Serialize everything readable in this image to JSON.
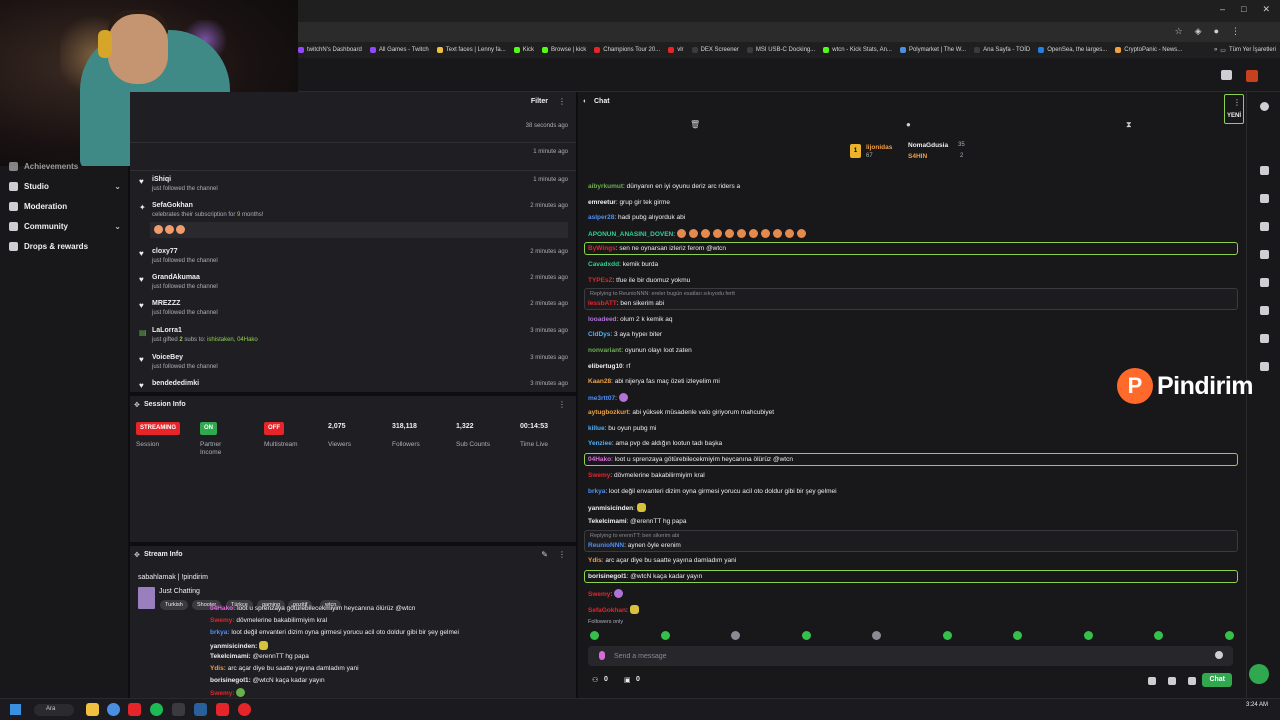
{
  "bookmarks": [
    "twitchN's Dashboard",
    "All Games - Twitch",
    "Text faces | Lenny fa...",
    "Kick",
    "Browse | kick",
    "Champions Tour 20...",
    "vlr",
    "DEX Screener",
    "MSI USB-C Docking...",
    "wtcn - Kick Stats, An...",
    "Polymarket | The W...",
    "Ana Sayfa - TOİD",
    "OpenSea, the larges...",
    "CryptoPanic - News..."
  ],
  "bookmarks_more": "Tüm Yer İşaretleri",
  "nav": {
    "partial_top": "Achievements",
    "items": [
      {
        "label": "Studio",
        "chevron": true
      },
      {
        "label": "Moderation",
        "chevron": false
      },
      {
        "label": "Community",
        "chevron": true
      },
      {
        "label": "Drops & rewards",
        "chevron": false
      }
    ]
  },
  "activity": {
    "filter_label": "Filter",
    "menu": "⋮",
    "top_times": [
      "38 seconds ago",
      "1 minute ago"
    ],
    "rows": [
      {
        "name": "iShiqi",
        "desc": "just followed the channel",
        "time": "1 minute ago",
        "icon": "heart"
      },
      {
        "name": "SefaGokhan",
        "desc_pre": "celebrates their subscription for ",
        "desc_num": "9",
        "desc_post": " months!",
        "time": "2 minutes ago",
        "icon": "star"
      },
      {
        "name": "cloxy77",
        "desc": "just followed the channel",
        "time": "2 minutes ago",
        "icon": "heart"
      },
      {
        "name": "GrandAkumaa",
        "desc": "just followed the channel",
        "time": "2 minutes ago",
        "icon": "heart"
      },
      {
        "name": "MREZZZ",
        "desc": "just followed the channel",
        "time": "2 minutes ago",
        "icon": "heart"
      },
      {
        "name": "LaLorra1",
        "desc_pre": "just gifted ",
        "desc_num": "2",
        "desc_mid": " subs to: ",
        "desc_post": "ishistaken, 04Hako",
        "time": "3 minutes ago",
        "icon": "gift"
      },
      {
        "name": "VoiceBey",
        "desc": "just followed the channel",
        "time": "3 minutes ago",
        "icon": "heart"
      },
      {
        "name": "bendededimki",
        "desc": "",
        "time": "3 minutes ago",
        "icon": "heart"
      }
    ]
  },
  "session": {
    "title": "Session Info",
    "menu": "⋮",
    "badges": [
      {
        "text": "STREAMING",
        "label": "Session",
        "color": "#e5252a"
      },
      {
        "text": "ON",
        "label": "Partner Income",
        "color": "#2fa84f"
      },
      {
        "text": "OFF",
        "label": "Multistream",
        "color": "#e5252a"
      }
    ],
    "stats": [
      {
        "value": "2,075",
        "label": "Viewers"
      },
      {
        "value": "318,118",
        "label": "Followers"
      },
      {
        "value": "1,322",
        "label": "Sub Counts"
      },
      {
        "value": "00:14:53",
        "label": "Time Live"
      }
    ]
  },
  "stream_info": {
    "title": "Stream Info",
    "stream_title": "sabahlamak | !pindirim",
    "game": "Just Chatting",
    "tags": [
      "Turkish",
      "Shooter",
      "Türkçe",
      "gaming",
      "pozitif",
      "wtcn"
    ],
    "chat_lines": [
      {
        "user": "04Hako:",
        "text": "loot u sprenzaya götürebilecekmiyim heycanına ölürüz @wtcn",
        "color": "#d96ad8"
      },
      {
        "user": "Swemy:",
        "text": "dövmelerine bakabilirmiyim kral",
        "color": "#e5252a"
      },
      {
        "user": "brkya:",
        "text": "loot değil envanteri dizim oyna girmesi yorucu acil oto doldur gibi bir şey gelmei",
        "color": "#4f8ff7"
      },
      {
        "user": "yanmisicinden:",
        "text": "",
        "color": "#efeff1"
      },
      {
        "user": "Tekelcimami:",
        "text": "@erennTT hg papa",
        "color": "#efeff1"
      },
      {
        "user": "Ydis:",
        "text": "arc açar diye bu saatte yayına damladım yani",
        "color": "#f0a040"
      },
      {
        "user": "borisinegol1:",
        "text": "@wtcN kaça kadar yayın",
        "color": "#efeff1"
      },
      {
        "user": "Swemy:",
        "text": "",
        "color": "#e5252a"
      }
    ]
  },
  "chat": {
    "title": "Chat",
    "leaderboard": [
      {
        "rank": "1",
        "name": "lijonidas",
        "sub": "67"
      },
      {
        "name": "NomaGdusia",
        "sub": "35"
      },
      {
        "name": "S4HIN",
        "sub": "2"
      }
    ],
    "messages": [
      {
        "user": "aibyrkumut",
        "text": ": dünyanın en iyi oyunu deriz arc riders a",
        "color": "#6ab04c"
      },
      {
        "user": "emreetur",
        "text": ": grup gir tek girme",
        "color": "#efeff1"
      },
      {
        "user": "aslper28",
        "text": ": hadi pubg alıyorduk abi",
        "color": "#4f8ff7"
      },
      {
        "user": "APONUN_ANASINI_DOVEN",
        "text": ":",
        "color": "#2fd18f",
        "emotes": 11
      },
      {
        "user": "ByWings",
        "text": ": sen ne oynarsan izleriz ferom @wtcn",
        "color": "#e5252a",
        "highlight": true
      },
      {
        "user": "Cavadxdd",
        "text": ": kemik burda",
        "color": "#2fd18f"
      },
      {
        "user": "TYPEsZ",
        "text": ": tfue ile bir duomuz yokmu",
        "color": "#e5252a"
      },
      {
        "user": "lessbATT",
        "text": ": ben sikerim abi",
        "color": "#e5252a",
        "reply": "Replying to ReunioNNN: ereler bugün esatları sıkıyodu fertt"
      },
      {
        "user": "looadeed",
        "text": ": olum 2 k kemik aq",
        "color": "#b074d6"
      },
      {
        "user": "CldDys",
        "text": ": 3 aya hypeı biter",
        "color": "#4fb0f7"
      },
      {
        "user": "nonvariant",
        "text": ": oyunun olayı loot zaten",
        "color": "#6ab04c"
      },
      {
        "user": "elibertug10",
        "text": ": rf",
        "color": "#efeff1"
      },
      {
        "user": "Kaan28",
        "text": ": abi nijerya fas maç özeti izleyelim mi",
        "color": "#f0a040"
      },
      {
        "user": "me3rtt07",
        "text": ":",
        "color": "#4f8ff7",
        "emotes": 1
      },
      {
        "user": "aytugbozkurt",
        "text": ": abi yüksek müsadenle valo giriyorum mahcubiyet",
        "color": "#f0a040"
      },
      {
        "user": "killue",
        "text": ": bu oyun pubg mi",
        "color": "#4fb0f7"
      },
      {
        "user": "Yenziee",
        "text": ": ama pvp de aldığın lootun tadı başka",
        "color": "#4fb0f7"
      },
      {
        "user": "04Hako",
        "text": ": loot u sprenzaya götürebilecekmiyim heycanına ölürüz @wtcn",
        "color": "#d96ad8",
        "highlight": true
      },
      {
        "user": "Swemy",
        "text": ": dövmelerine bakabilirmiyim kral",
        "color": "#e5252a"
      },
      {
        "user": "brkya",
        "text": ": loot değil envanteri dizim oyna girmesi yorucu acil oto doldur gibi bir şey gelmei",
        "color": "#4f8ff7"
      },
      {
        "user": "yanmisicinden",
        "text": ":",
        "color": "#efeff1",
        "emotes": 1
      },
      {
        "user": "Tekelcimami",
        "text": ": @erennTT hg papa",
        "color": "#efeff1"
      },
      {
        "user": "ReunioNNN",
        "text": ": aynen öyle erenim",
        "color": "#4f8ff7",
        "reply": "Replying to erennTT: ben sikerim abi"
      },
      {
        "user": "Ydis",
        "text": ": arc açar diye bu saatte yayına damladım yani",
        "color": "#f0a040"
      },
      {
        "user": "borisinegol1",
        "text": ": @wtcN kaça kadar yayın",
        "color": "#efeff1",
        "highlight": true
      },
      {
        "user": "Swemy",
        "text": ":",
        "color": "#e5252a",
        "emotes": 1
      },
      {
        "user": "SefaGokhan",
        "text": ":",
        "color": "#e5252a",
        "emotes": 1
      }
    ],
    "followers_only": "Followers only",
    "placeholder": "Send a message",
    "points": "0",
    "bits": "0",
    "send_label": "Chat"
  },
  "new_badge": "YENİ",
  "logo_text": "Pindirim",
  "taskbar": {
    "search": "Ara",
    "time": "3:24 AM"
  }
}
